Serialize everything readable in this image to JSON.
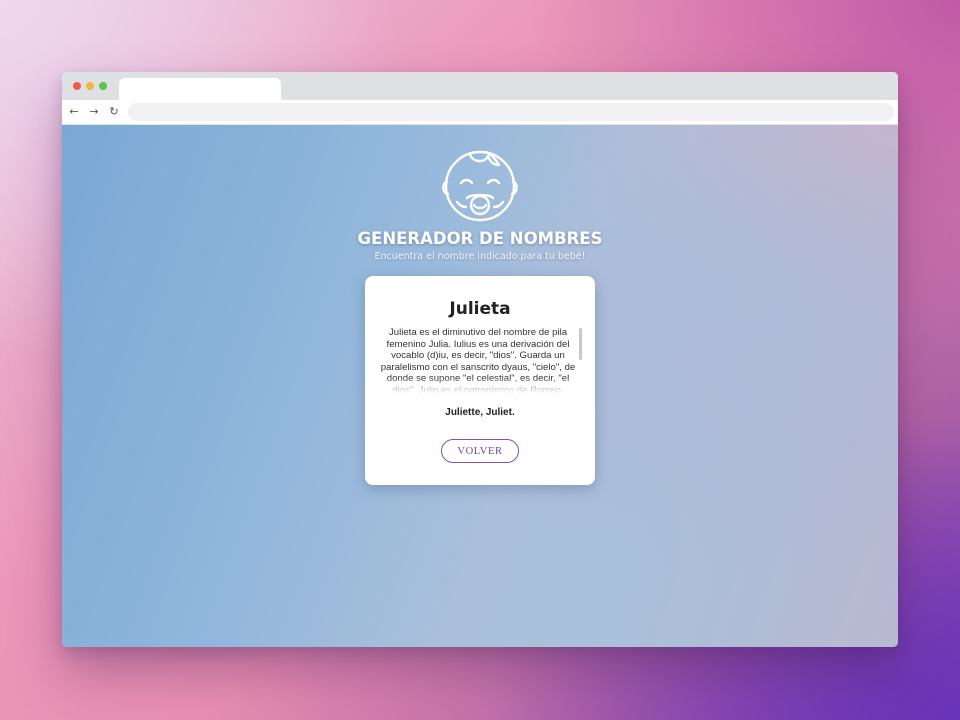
{
  "browser": {
    "tab_title": "",
    "url": "",
    "nav": {
      "back_icon": "←",
      "forward_icon": "→",
      "reload_icon": "↻"
    }
  },
  "app": {
    "logo_icon": "baby-face-icon",
    "title": "GENERADOR DE NOMBRES",
    "subtitle": "Encuentra el nombre indicado para tu bebé!"
  },
  "result": {
    "name": "Julieta",
    "description": "Julieta es el diminutivo del nombre de pila femenino Julia. Iulius es una derivación del vocablo (d)iu, es decir, \"dios\". Guarda un paralelismo con el sanscrito dyaus, \"cielo\", de donde se supone \"el celestial\", es decir, \"el dios\". Julio es el patronímico de Romeo.",
    "variants": "Juliette, Juliet.",
    "back_button": "VOLVER"
  },
  "colors": {
    "accent": "#8a4fa6",
    "card_bg": "#ffffff",
    "title_text": "#ffffff"
  }
}
